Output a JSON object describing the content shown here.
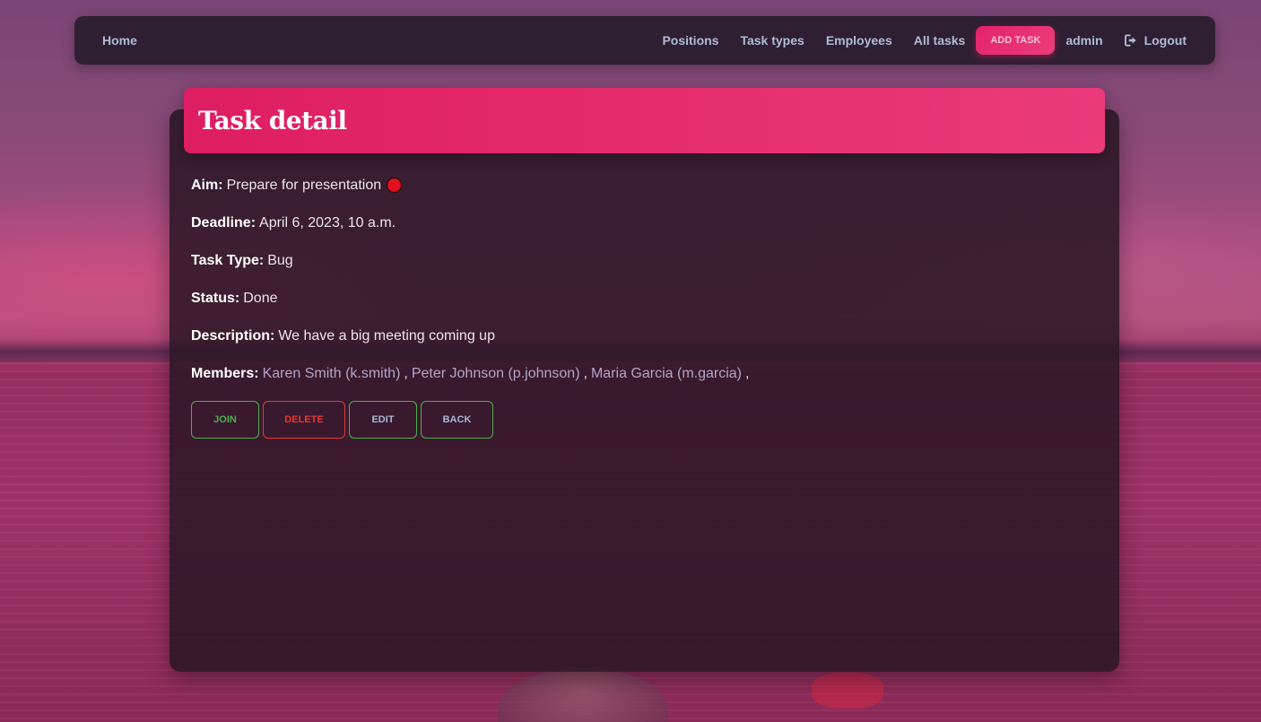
{
  "colors": {
    "accent": "#e91e63",
    "join": "#4caf50",
    "delete": "#e53935",
    "status_dot": "#e0101c"
  },
  "navbar": {
    "home": "Home",
    "positions": "Positions",
    "task_types": "Task types",
    "employees": "Employees",
    "all_tasks": "All tasks",
    "add_task": "ADD TASK",
    "user": "admin",
    "logout": "Logout",
    "logout_icon": "sign-out-icon"
  },
  "task": {
    "page_title": "Task detail",
    "aim_label": "Aim:",
    "aim": "Prepare for presentation",
    "status_icon": "red-circle",
    "deadline_label": "Deadline:",
    "deadline": "April 6, 2023, 10 a.m.",
    "task_type_label": "Task Type:",
    "task_type": "Bug",
    "status_label": "Status:",
    "status": "Done",
    "description_label": "Description:",
    "description": "We have a big meeting coming up",
    "members_label": "Members:",
    "members": [
      "Karen Smith (k.smith)",
      "Peter Johnson (p.johnson)",
      "Maria Garcia (m.garcia)"
    ],
    "separator": ","
  },
  "actions": {
    "join": "JOIN",
    "delete": "DELETE",
    "edit": "EDIT",
    "back": "BACK"
  }
}
